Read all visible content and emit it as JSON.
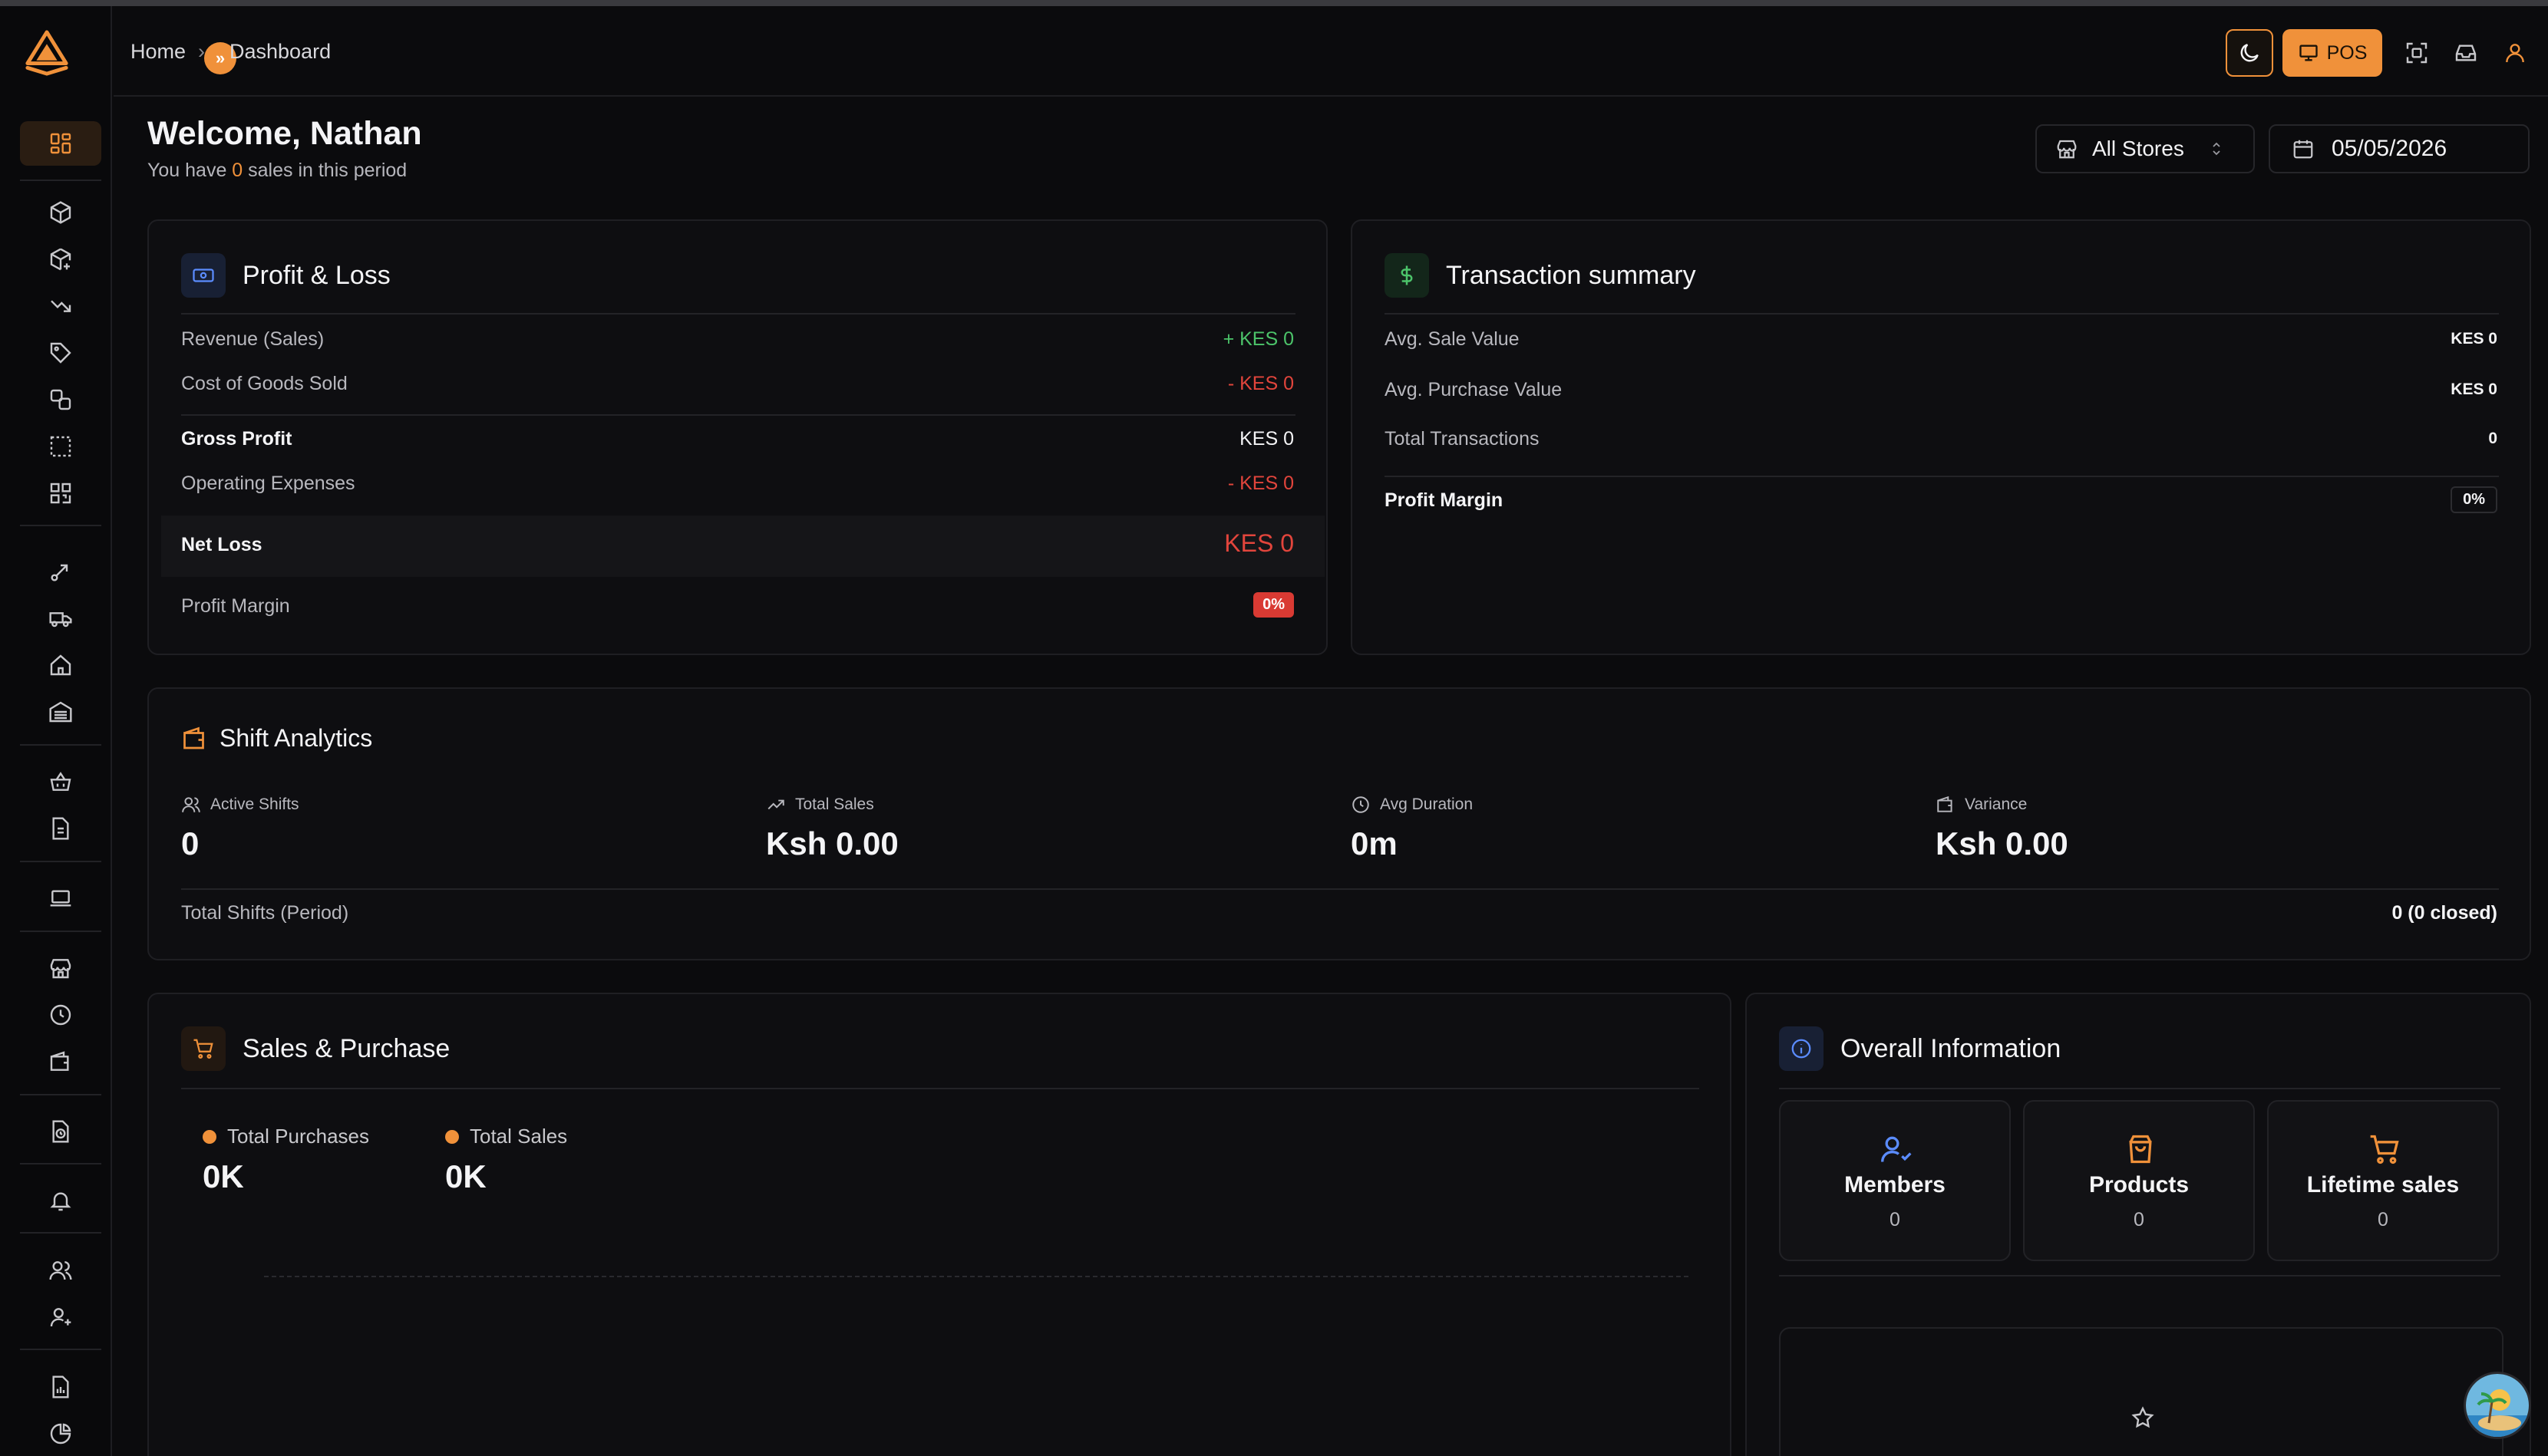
{
  "breadcrumb": {
    "home": "Home",
    "current": "Dashboard"
  },
  "header": {
    "pos_label": "POS",
    "expand_icon": "chevrons-right-icon"
  },
  "welcome": {
    "prefix": "Welcome, ",
    "name": "Nathan",
    "sub_before": "You have ",
    "sales_count": "0",
    "sub_after": " sales in this period"
  },
  "filters": {
    "store": "All Stores",
    "date": "05/05/2026"
  },
  "profit_loss": {
    "title": "Profit & Loss",
    "rows": [
      {
        "label": "Revenue (Sales)",
        "value": "+ KES 0"
      },
      {
        "label": "Cost of Goods Sold",
        "value": "- KES 0"
      },
      {
        "label": "Gross Profit",
        "value": "KES 0"
      },
      {
        "label": "Operating Expenses",
        "value": "- KES 0"
      },
      {
        "label": "Net Loss",
        "value": "KES 0"
      },
      {
        "label": "Profit Margin",
        "value": "0%"
      }
    ]
  },
  "transaction_summary": {
    "title": "Transaction summary",
    "rows": [
      {
        "label": "Avg. Sale Value",
        "value": "KES 0"
      },
      {
        "label": "Avg. Purchase Value",
        "value": "KES 0"
      },
      {
        "label": "Total Transactions",
        "value": "0"
      },
      {
        "label": "Profit Margin",
        "value": "0%"
      }
    ]
  },
  "shift_analytics": {
    "title": "Shift Analytics",
    "stats": [
      {
        "label": "Active Shifts",
        "value": "0",
        "icon": "users-icon"
      },
      {
        "label": "Total Sales",
        "value": "Ksh 0.00",
        "icon": "trending-up-icon"
      },
      {
        "label": "Avg Duration",
        "value": "0m",
        "icon": "clock-icon"
      },
      {
        "label": "Variance",
        "value": "Ksh 0.00",
        "icon": "wallet-icon"
      }
    ],
    "total_label": "Total Shifts (Period)",
    "total_value": "0 (0 closed)"
  },
  "sales_purchase": {
    "title": "Sales & Purchase",
    "legend": [
      {
        "label": "Total Purchases",
        "value": "0K"
      },
      {
        "label": "Total Sales",
        "value": "0K"
      }
    ],
    "accent": "#f0913a"
  },
  "overall_info": {
    "title": "Overall Information",
    "tiles": [
      {
        "label": "Members",
        "value": "0",
        "icon": "user-check-icon"
      },
      {
        "label": "Products",
        "value": "0",
        "icon": "shopping-bag-icon"
      },
      {
        "label": "Lifetime sales",
        "value": "0",
        "icon": "shopping-cart-icon"
      }
    ]
  },
  "sidebar": {
    "icons": [
      "dashboard-icon",
      "package-icon",
      "package-plus-icon",
      "trending-down-icon",
      "tag-icon",
      "transfer-icon",
      "selection-icon",
      "qr-code-icon",
      "route-icon",
      "truck-icon",
      "home-icon",
      "warehouse-icon",
      "basket-icon",
      "file-icon",
      "laptop-icon",
      "store-icon",
      "clock-icon",
      "wallet-icon",
      "file-clock-icon",
      "bell-icon",
      "users-icon",
      "user-plus-icon",
      "report-icon",
      "pie-chart-icon"
    ]
  },
  "colors": {
    "accent": "#f0913a",
    "positive": "#4cc46a",
    "negative": "#e2453c",
    "background": "#0b0b0d"
  }
}
